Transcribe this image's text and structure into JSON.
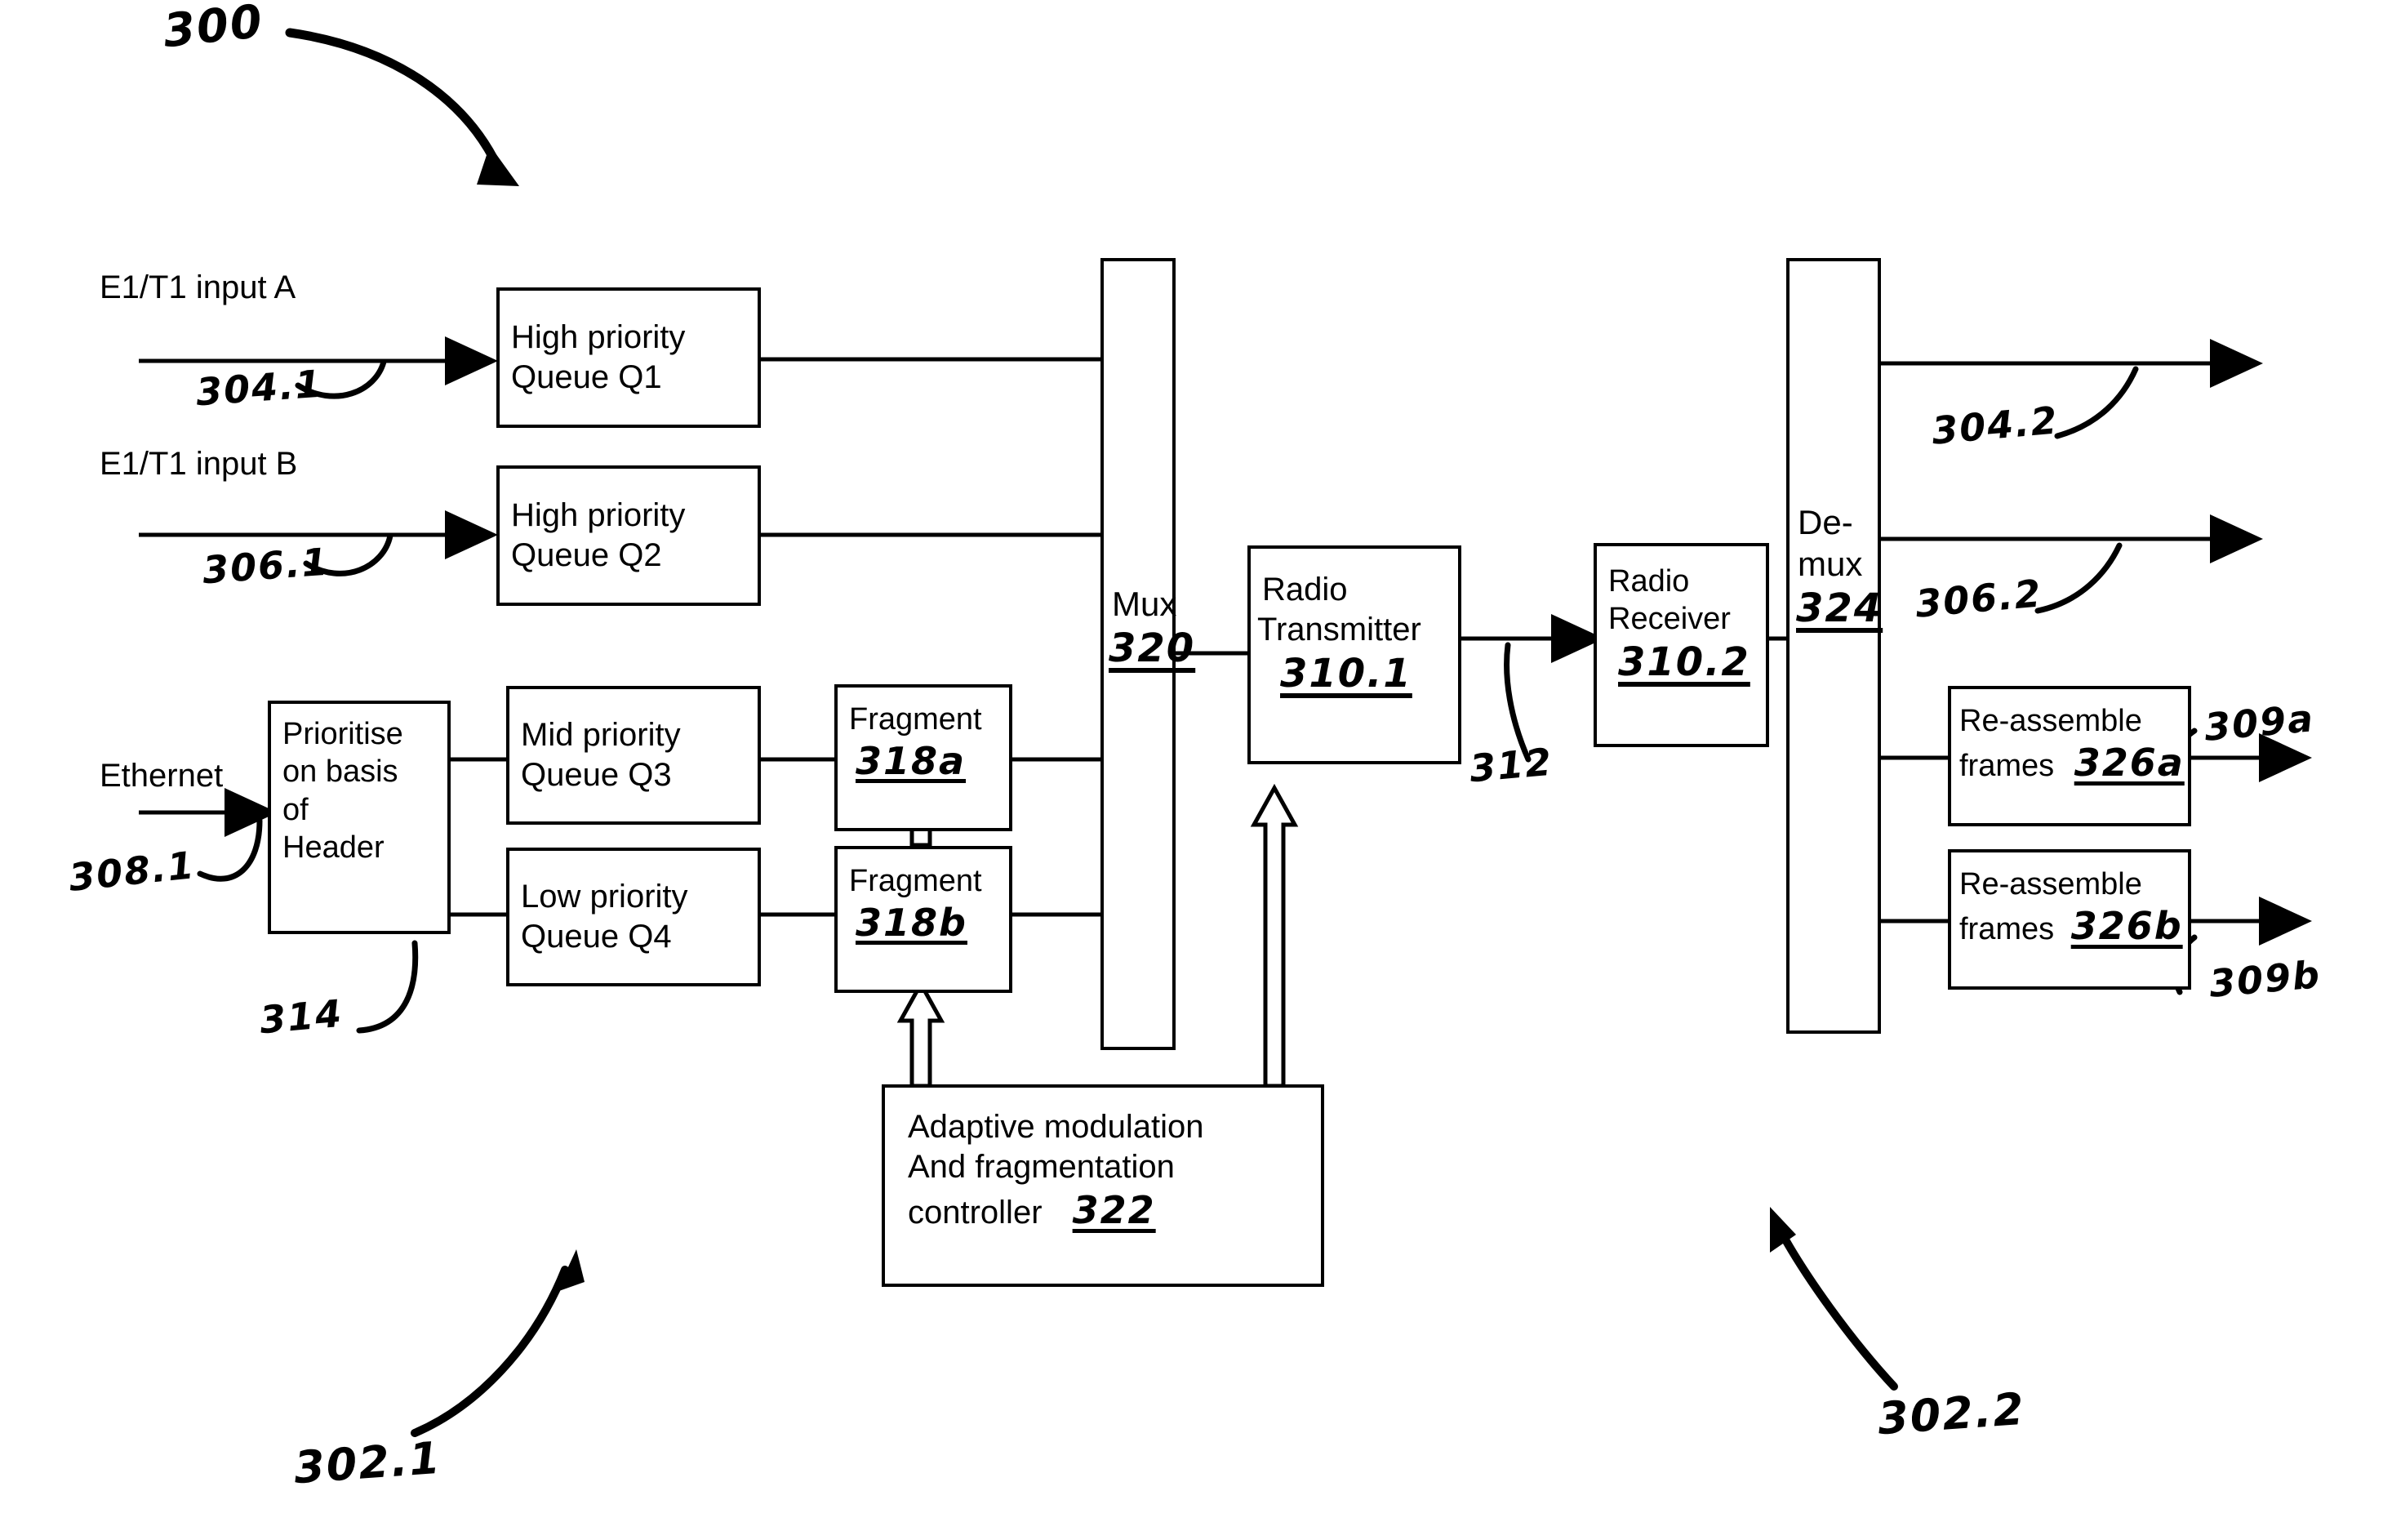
{
  "figure": {
    "figure_ref": "300",
    "transmitter_side_ref": "302.1",
    "receiver_side_ref": "302.2"
  },
  "inputs": [
    {
      "label": "E1/T1 input A",
      "ref": "304.1"
    },
    {
      "label": "E1/T1 input B",
      "ref": "306.1"
    },
    {
      "label": "Ethernet",
      "ref": "308.1"
    }
  ],
  "blocks": {
    "q1": {
      "line1": "High priority",
      "line2": "Queue Q1"
    },
    "q2": {
      "line1": "High priority",
      "line2": "Queue Q2"
    },
    "q3": {
      "line1": "Mid priority",
      "line2": "Queue Q3"
    },
    "q4": {
      "line1": "Low priority",
      "line2": "Queue Q4"
    },
    "prioritise": {
      "line1": "Prioritise",
      "line2": "on basis",
      "line3": "of",
      "line4": "Header",
      "ref": "314"
    },
    "fragment_a": {
      "label": "Fragment",
      "ref": "318a"
    },
    "fragment_b": {
      "label": "Fragment",
      "ref": "318b"
    },
    "mux": {
      "label": "Mux",
      "ref": "320"
    },
    "radio_tx": {
      "line1": "Radio",
      "line2": "Transmitter",
      "ref": "310.1"
    },
    "radio_rx": {
      "line1": "Radio",
      "line2": "Receiver",
      "ref": "310.2"
    },
    "demux": {
      "line1": "De-",
      "line2": "mux",
      "ref": "324"
    },
    "controller": {
      "line1": "Adaptive modulation",
      "line2": "And fragmentation",
      "line3": "controller",
      "ref": "322"
    },
    "reassemble_a": {
      "line1": "Re-assemble",
      "line2": "frames",
      "ref": "326a"
    },
    "reassemble_b": {
      "line1": "Re-assemble",
      "line2": "frames",
      "ref": "326b"
    }
  },
  "links": {
    "radio_link_ref": "312"
  },
  "outputs": [
    {
      "ref": "304.2"
    },
    {
      "ref": "306.2"
    },
    {
      "ref": "309a"
    },
    {
      "ref": "309b"
    }
  ],
  "colors": {
    "ink": "#000000",
    "background": "#ffffff"
  }
}
